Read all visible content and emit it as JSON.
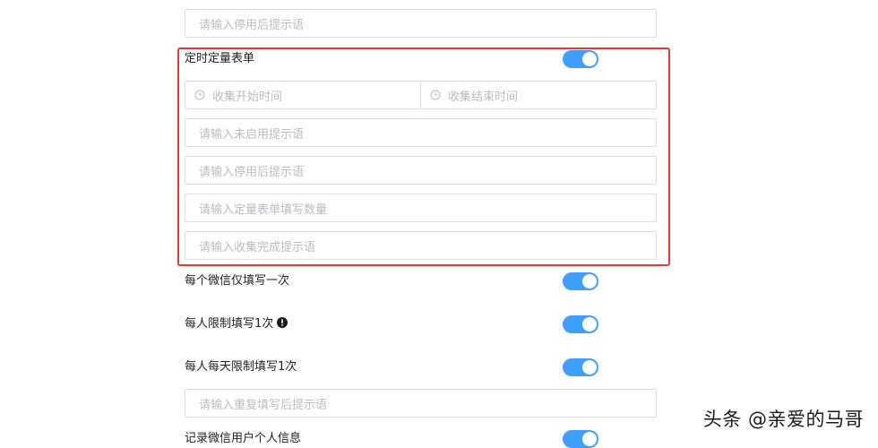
{
  "top_field": {
    "placeholder": "请输入停用后提示语"
  },
  "timed_section": {
    "label": "定时定量表单",
    "switch_on": true,
    "date_range": {
      "start_placeholder": "收集开始时间",
      "end_placeholder": "收集结束时间"
    },
    "fields": [
      {
        "placeholder": "请输入未启用提示语"
      },
      {
        "placeholder": "请输入停用后提示语"
      },
      {
        "placeholder": "请输入定量表单填写数量"
      },
      {
        "placeholder": "请输入收集完成提示语"
      }
    ]
  },
  "settings": [
    {
      "label": "每个微信仅填写一次",
      "switch_on": true
    },
    {
      "label": "每人限制填写1次",
      "switch_on": true,
      "has_info": true
    },
    {
      "label": "每人每天限制填写1次",
      "switch_on": true
    }
  ],
  "repeat_field": {
    "placeholder": "请输入重复填写后提示语"
  },
  "record_wechat": {
    "label": "记录微信用户个人信息",
    "switch_on": true
  },
  "watermark": "头条 @亲爱的马哥",
  "colors": {
    "accent": "#409eff",
    "highlight": "#e53935",
    "border": "#dcdfe6",
    "placeholder": "#b8bcc4"
  }
}
